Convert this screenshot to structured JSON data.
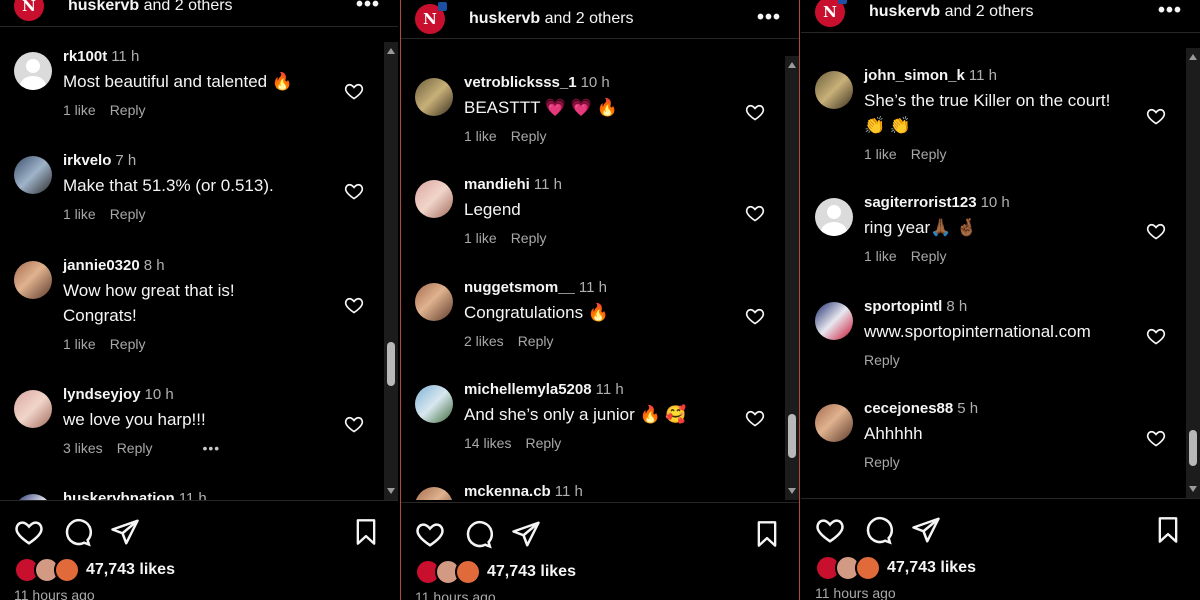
{
  "panels": [
    {
      "header": {
        "user": "huskervb",
        "rest": " and 2 others"
      },
      "comments": [
        {
          "user": "rk100t",
          "time": "11 h",
          "text": "Most beautiful and talented 🔥",
          "likes": "1 like",
          "reply": "Reply"
        },
        {
          "user": "irkvelo",
          "time": "7 h",
          "text": "Make that 51.3% (or 0.513).",
          "likes": "1 like",
          "reply": "Reply"
        },
        {
          "user": "jannie0320",
          "time": "8 h",
          "text": "Wow how great that is! Congrats!",
          "likes": "1 like",
          "reply": "Reply"
        },
        {
          "user": "lyndseyjoy",
          "time": "10 h",
          "text": "we love you harp!!!",
          "likes": "3 likes",
          "reply": "Reply",
          "more": "•••"
        },
        {
          "user": "huskervbnation",
          "time": "11 h",
          "text": "",
          "likes": "",
          "reply": ""
        }
      ],
      "footer": {
        "likes": "47,743 likes",
        "ago": "11 hours ago"
      }
    },
    {
      "header": {
        "user": "huskervb",
        "rest": " and 2 others"
      },
      "comments": [
        {
          "user": "vetroblicksss_1",
          "time": "10 h",
          "text": "BEASTTT 💗 💗 🔥",
          "likes": "1 like",
          "reply": "Reply"
        },
        {
          "user": "mandiehi",
          "time": "11 h",
          "text": "Legend",
          "likes": "1 like",
          "reply": "Reply"
        },
        {
          "user": "nuggetsmom__",
          "time": "11 h",
          "text": "Congratulations 🔥",
          "likes": "2 likes",
          "reply": "Reply"
        },
        {
          "user": "michellemyla5208",
          "time": "11 h",
          "text": "And she’s only a junior 🔥 🥰",
          "likes": "14 likes",
          "reply": "Reply"
        },
        {
          "user": "mckenna.cb",
          "time": "11 h",
          "text": "",
          "likes": "",
          "reply": ""
        }
      ],
      "footer": {
        "likes": "47,743 likes",
        "ago": "11 hours ago"
      }
    },
    {
      "header": {
        "user": "huskervb",
        "rest": " and 2 others"
      },
      "comments": [
        {
          "user": "john_simon_k",
          "time": "11 h",
          "text": "She’s the true Killer on the court! 👏 👏",
          "likes": "1 like",
          "reply": "Reply"
        },
        {
          "user": "sagiterrorist123",
          "time": "10 h",
          "text": "ring year🙏🏾 🤞🏾",
          "likes": "1 like",
          "reply": "Reply"
        },
        {
          "user": "sportopintl",
          "time": "8 h",
          "text": "www.sportopinternational.com",
          "likes": "",
          "reply": "Reply"
        },
        {
          "user": "cecejones88",
          "time": "5 h",
          "text": "Ahhhhh",
          "likes": "",
          "reply": "Reply"
        }
      ],
      "footer": {
        "likes": "47,743 likes",
        "ago": "11 hours ago"
      }
    }
  ],
  "colors": {
    "background": "#000000",
    "divider": "#b04a3a",
    "brand": "#c8102e"
  },
  "icons": [
    "heart-icon",
    "comment-icon",
    "share-icon",
    "bookmark-icon",
    "more-icon"
  ]
}
